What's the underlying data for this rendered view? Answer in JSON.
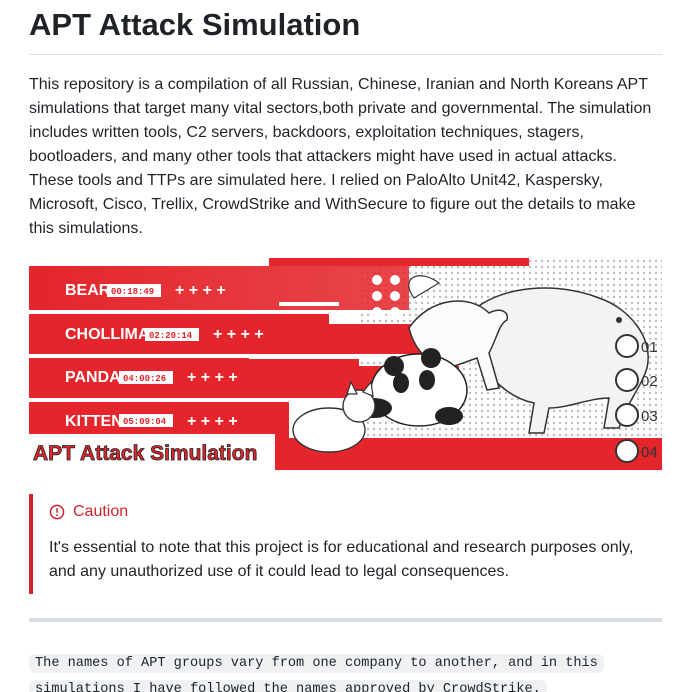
{
  "title": "APT Attack Simulation",
  "intro": "This repository is a compilation of all Russian, Chinese, Iranian and North Koreans APT simulations that target many vital sectors,both private and governmental. The simulation includes written tools, C2 servers, backdoors, exploitation techniques, stagers, bootloaders, and many other tools that attackers might have used in actual attacks. These tools and TTPs are simulated here. I relied on PaloAlto Unit42, Kaspersky, Microsoft, Cisco, Trellix, CrowdStrike and WithSecure to figure out the details to make this simulations.",
  "banner": {
    "heading": "APT Attack Simulation",
    "rows": [
      {
        "name": "BEAR",
        "time": "00:18:49",
        "plus": "+ + + +",
        "num": "01"
      },
      {
        "name": "CHOLLIMA",
        "time": "02:20:14",
        "plus": "+ + + +",
        "num": "02"
      },
      {
        "name": "PANDA",
        "time": "04:00:26",
        "plus": "+ + + +",
        "num": "03"
      },
      {
        "name": "KITTEN",
        "time": "05:09:04",
        "plus": "+ + + +",
        "num": "04"
      }
    ],
    "colors": {
      "red": "#e4252b",
      "dark": "#3a3a3a"
    }
  },
  "caution": {
    "label": "Caution",
    "text": "It's essential to note that this project is for educational and research purposes only, and any unauthorized use of it could lead to legal consequences."
  },
  "code_note": {
    "line1": "The names of APT groups vary from one company to another, and in this",
    "line2": "simulations I have followed the names approved by CrowdStrike."
  }
}
